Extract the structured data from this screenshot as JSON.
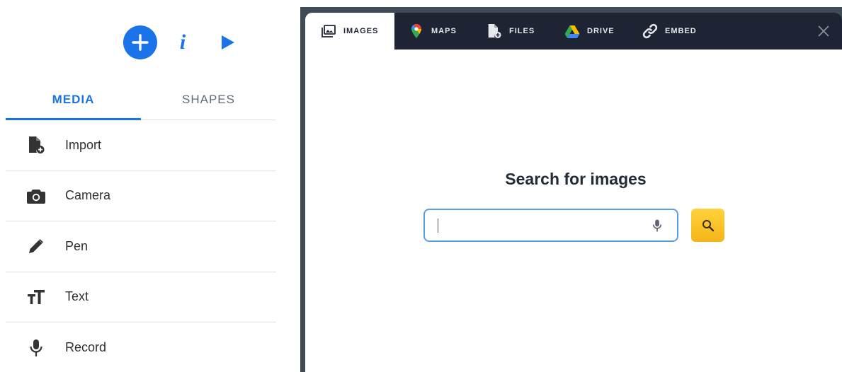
{
  "toolbar": {
    "add_icon": "plus-icon",
    "info_label": "i",
    "play_icon": "play-icon",
    "accent": "#1a73e8"
  },
  "tabs": [
    {
      "label": "MEDIA",
      "active": true
    },
    {
      "label": "SHAPES",
      "active": false
    }
  ],
  "media_items": [
    {
      "label": "Import",
      "icon": "file-add-icon"
    },
    {
      "label": "Camera",
      "icon": "camera-icon"
    },
    {
      "label": "Pen",
      "icon": "pen-icon"
    },
    {
      "label": "Text",
      "icon": "text-size-icon"
    },
    {
      "label": "Record",
      "icon": "mic-icon"
    }
  ],
  "dialog": {
    "tabs": [
      {
        "label": "IMAGES",
        "icon": "images-icon",
        "active": true
      },
      {
        "label": "MAPS",
        "icon": "google-maps-icon",
        "active": false
      },
      {
        "label": "FILES",
        "icon": "file-add-icon",
        "active": false
      },
      {
        "label": "DRIVE",
        "icon": "google-drive-icon",
        "active": false
      },
      {
        "label": "EMBED",
        "icon": "link-icon",
        "active": false
      }
    ],
    "close_icon": "close-icon",
    "search_title": "Search for images",
    "search_value": "",
    "search_placeholder": "",
    "search_button_color": "#fbbc1d"
  }
}
